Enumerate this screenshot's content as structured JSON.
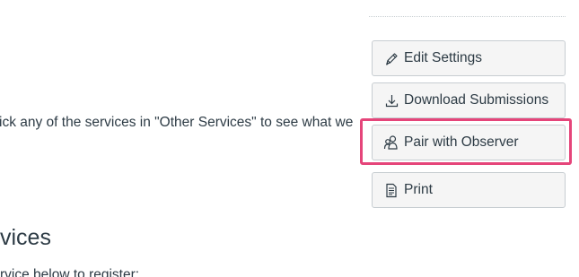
{
  "sidebar": {
    "edit_settings": {
      "label": "Edit Settings",
      "icon": "pencil-icon"
    },
    "download_submissions": {
      "label": "Download Submissions",
      "icon": "download-icon"
    },
    "pair_with_observer": {
      "label": "Pair with Observer",
      "icon": "observer-icon"
    },
    "print": {
      "label": "Print",
      "icon": "print-icon"
    }
  },
  "main": {
    "instruction_text": "ick any of the services in \"Other Services\" to see what we",
    "section_heading": "vices",
    "section_subtext": "rvice below to register:"
  },
  "colors": {
    "focus_ring": "#e5457a",
    "button_bg": "#f5f5f5",
    "button_border": "#c7cdd1",
    "text": "#2d3b45"
  }
}
